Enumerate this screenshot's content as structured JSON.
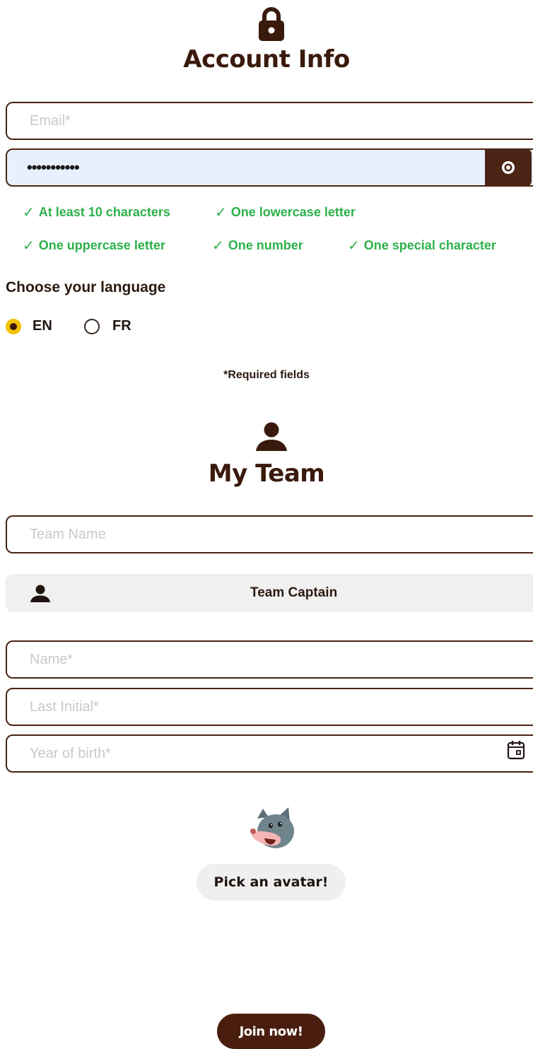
{
  "account": {
    "title": "Account Info",
    "email_placeholder": "Email*",
    "password_value": "•••••••••••",
    "rules": [
      "At least 10 characters",
      "One lowercase letter",
      "One uppercase letter",
      "One number",
      "One special character"
    ],
    "language_label": "Choose your language",
    "languages": [
      {
        "label": "EN",
        "selected": true
      },
      {
        "label": "FR",
        "selected": false
      }
    ],
    "required_note": "*Required fields"
  },
  "team": {
    "title": "My Team",
    "team_name_placeholder": "Team Name",
    "captain_label": "Team Captain",
    "name_placeholder": "Name*",
    "last_initial_placeholder": "Last Initial*",
    "year_placeholder": "Year of birth*",
    "avatar_button": "Pick an avatar!"
  },
  "join_button": "Join now!",
  "icons": {
    "lock": "lock-icon",
    "eye": "eye-icon",
    "check": "check-icon",
    "user": "user-icon",
    "calendar": "calendar-icon",
    "avatar": "cat-avatar-icon"
  },
  "colors": {
    "brand_brown": "#4a2414",
    "success_green": "#2db14a",
    "radio_yellow": "#f2c200",
    "password_bg": "#e8f0fe"
  }
}
